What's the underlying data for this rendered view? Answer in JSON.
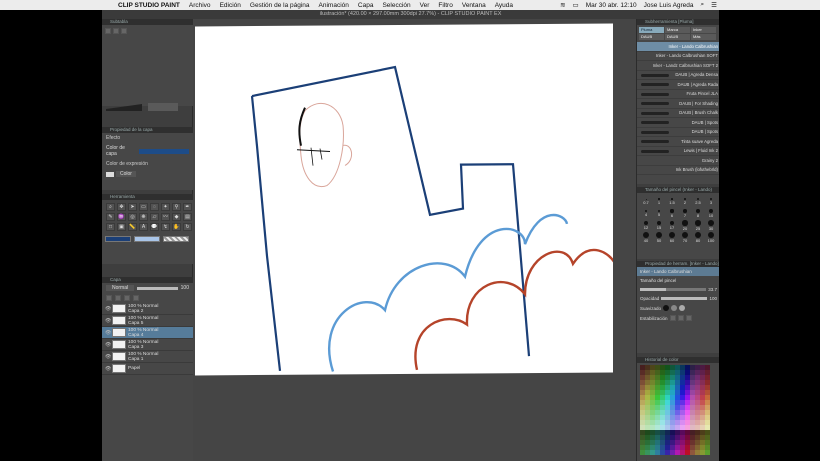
{
  "menubar": {
    "app": "CLIP STUDIO PAINT",
    "items": [
      "Archivo",
      "Edición",
      "Gestión de la página",
      "Animación",
      "Capa",
      "Selección",
      "Ver",
      "Filtro",
      "Ventana",
      "Ayuda"
    ],
    "datetime": "Mar 30 abr. 12:10",
    "user": "Jose Luis Agreda"
  },
  "window": {
    "doc_title": "ilustración* (420.00 × 297.00mm 300dpi 27.7%) - CLIP STUDIO PAINT EX"
  },
  "left": {
    "subtool_title": "Subtabla",
    "props_title": "Propiedad de la capa",
    "effect_label": "Efecto",
    "layer_color_label": "Color de capa",
    "expression_color_label": "Color de expresión",
    "expression_value": "Color",
    "tools_title": "Herramienta",
    "layers_title": "Capa",
    "blend_mode": "Normal",
    "opacity": "100",
    "layers": [
      {
        "opacity": "100 % Normal",
        "name": "Capa 2"
      },
      {
        "opacity": "100 % Normal",
        "name": "Capa 5"
      },
      {
        "opacity": "100 % Normal",
        "name": "Capa 4"
      },
      {
        "opacity": "100 % Normal",
        "name": "Capa 3"
      },
      {
        "opacity": "100 % Normal",
        "name": "Capa 1"
      },
      {
        "opacity": "",
        "name": "Papel"
      }
    ]
  },
  "right": {
    "brushset_title": "Subherramienta [Pluma]",
    "tabs": [
      "Pluma",
      "Marca",
      "Inker",
      "DAUB",
      "DAUB",
      "Más"
    ],
    "brushes": [
      "Inker - Lando Calbrushian",
      "Inker - Lando Calbrushian SOFT",
      "Inker - Landz Calbrushian SOFT 2",
      "DAUB | Agreda Densa",
      "DAUB | Agreda Rada",
      "Fruta Pincel JLA",
      "DAUB | For Shading",
      "DAUB | Brush Chalk",
      "DAUB | Spots",
      "DAUB | Spots",
      "Tinta suave Agreda",
      "Lewis | Fluid Ink 2",
      "Grainy 2",
      "Ink Brush (lofuthebrld)"
    ],
    "sizes_title": "Tamaño del pincel (Inker - Lando)",
    "sizes": [
      "0.7",
      "1",
      "1.5",
      "2",
      "2.5",
      "3",
      "4",
      "5",
      "6",
      "7",
      "8",
      "10",
      "12",
      "15",
      "17",
      "20",
      "25",
      "30",
      "40",
      "50",
      "60",
      "70",
      "80",
      "100"
    ],
    "toolprop_title": "Propiedad de herram. [Inker - Lando]",
    "toolprop_name": "Inker - Lando Calbrushian",
    "brush_size_label": "Tamaño del pincel",
    "brush_size_value": "33.7",
    "opacity_label": "Opacidad",
    "opacity_value": "100",
    "smoothing_label": "Suavizado",
    "stabilization_label": "Estabilización",
    "palette_title": "Historial de color"
  },
  "colors": {
    "stroke_dark_blue": "#1b3f77",
    "stroke_light_blue": "#5b9bd5",
    "stroke_red": "#b5442a",
    "sketch": "#d9a59a"
  }
}
